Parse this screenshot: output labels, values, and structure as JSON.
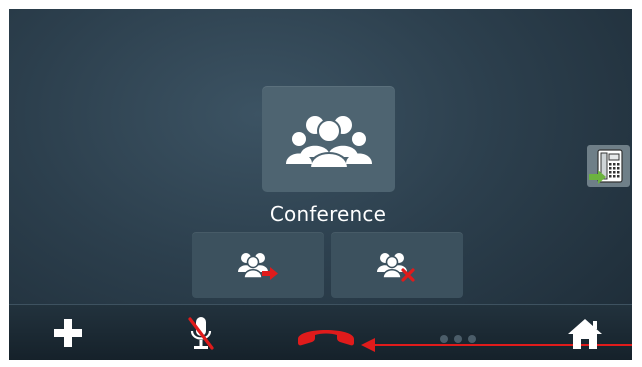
{
  "conference": {
    "label": "Conference"
  },
  "icons": {
    "conference": "conference-group-icon",
    "add_party": "add-party-icon",
    "remove_party": "remove-party-icon",
    "transfer": "call-transfer-icon",
    "add": "plus-icon",
    "mute": "microphone-muted-icon",
    "end_call": "end-call-handset-icon",
    "home": "home-icon"
  },
  "colors": {
    "accent_red": "#e01b1b",
    "accent_green": "#6cb33f",
    "icon_white": "#ffffff"
  },
  "pager": {
    "pages": 3,
    "current": 1
  }
}
